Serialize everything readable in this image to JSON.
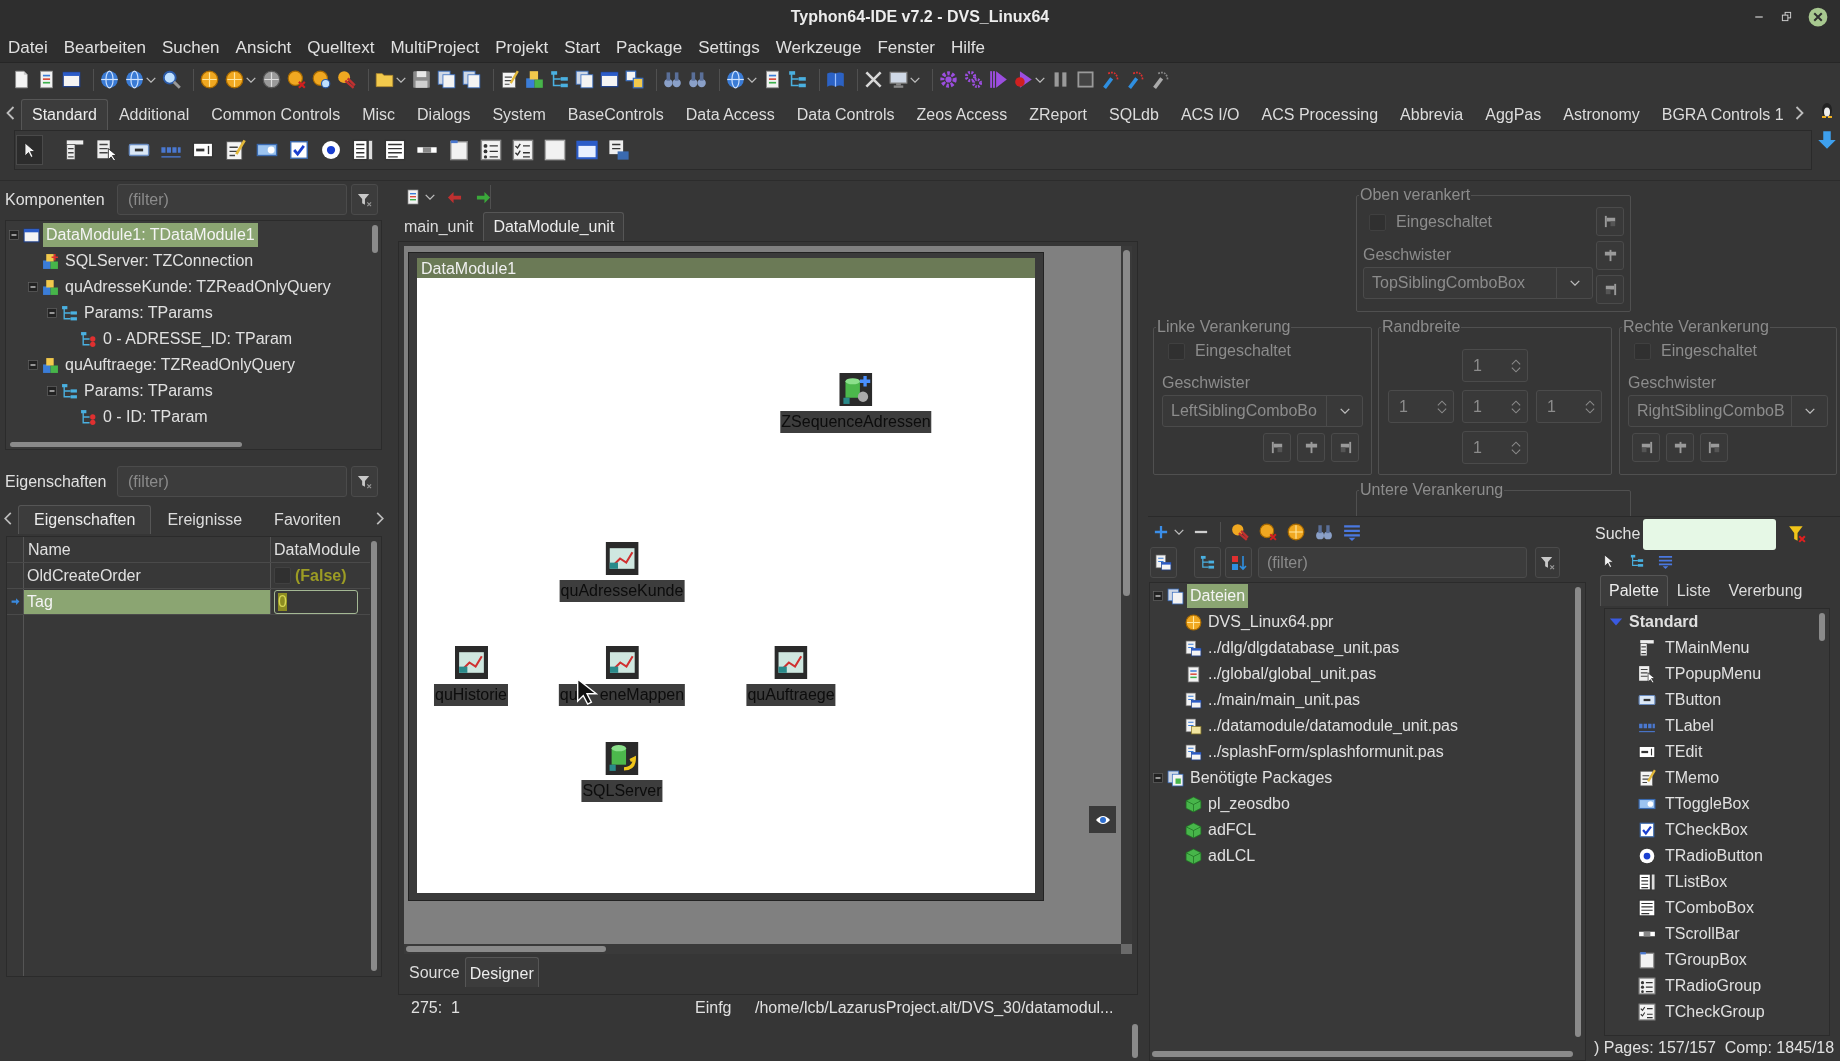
{
  "window": {
    "title": "Typhon64-IDE v7.2 - DVS_Linux64"
  },
  "menu": [
    "Datei",
    "Bearbeiten",
    "Suchen",
    "Ansicht",
    "Quelltext",
    "MultiProject",
    "Projekt",
    "Start",
    "Package",
    "Settings",
    "Werkzeuge",
    "Fenster",
    "Hilfe"
  ],
  "palette_tabs": [
    {
      "label": "Standard",
      "selected": true
    },
    {
      "label": "Additional",
      "selected": false
    },
    {
      "label": "Common Controls",
      "selected": false
    },
    {
      "label": "Misc",
      "selected": false
    },
    {
      "label": "Dialogs",
      "selected": false
    },
    {
      "label": "System",
      "selected": false
    },
    {
      "label": "BaseControls",
      "selected": false
    },
    {
      "label": "Data Access",
      "selected": false
    },
    {
      "label": "Data Controls",
      "selected": false
    },
    {
      "label": "Zeos Access",
      "selected": false
    },
    {
      "label": "ZReport",
      "selected": false
    },
    {
      "label": "SQLdb",
      "selected": false
    },
    {
      "label": "ACS I/O",
      "selected": false
    },
    {
      "label": "ACS Processing",
      "selected": false
    },
    {
      "label": "Abbrevia",
      "selected": false
    },
    {
      "label": "AggPas",
      "selected": false
    },
    {
      "label": "Astronomy",
      "selected": false
    },
    {
      "label": "BGRA Controls 1",
      "selected": false
    }
  ],
  "components": {
    "label": "Komponenten",
    "filter": {
      "placeholder": "(filter)"
    },
    "tree": [
      {
        "text": "DataModule1: TDataModule1",
        "kind": "datamodule",
        "selected": true,
        "expanded": true,
        "children": [
          {
            "text": "SQLServer: TZConnection",
            "kind": "connection",
            "selected": false
          },
          {
            "text": "quAdresseKunde: TZReadOnlyQuery",
            "kind": "query",
            "selected": false,
            "expanded": true,
            "children": [
              {
                "text": "Params: TParams",
                "kind": "params",
                "selected": false,
                "expanded": true,
                "children": [
                  {
                    "text": "0 - ADRESSE_ID: TParam",
                    "kind": "param",
                    "selected": false
                  }
                ]
              }
            ]
          },
          {
            "text": "quAuftraege: TZReadOnlyQuery",
            "kind": "query",
            "selected": false,
            "expanded": true,
            "children": [
              {
                "text": "Params: TParams",
                "kind": "params",
                "selected": false,
                "expanded": true,
                "children": [
                  {
                    "text": "0 - ID: TParam",
                    "kind": "param",
                    "selected": false
                  }
                ]
              }
            ]
          }
        ]
      }
    ]
  },
  "properties": {
    "label": "Eigenschaften",
    "filter": {
      "placeholder": "(filter)"
    },
    "tabs": [
      {
        "label": "Eigenschaften",
        "selected": true
      },
      {
        "label": "Ereignisse",
        "selected": false
      },
      {
        "label": "Favoriten",
        "selected": false
      }
    ],
    "columns": [
      "Name",
      "DataModule"
    ],
    "rows": [
      {
        "name": "OldCreateOrder",
        "kind": "bool",
        "value": "(False)",
        "checked": false,
        "selected": false
      },
      {
        "name": "Tag",
        "kind": "number",
        "value": "0",
        "selected": true
      }
    ]
  },
  "editor": {
    "tabs": [
      {
        "label": "main_unit",
        "selected": false
      },
      {
        "label": "DataModule_unit",
        "selected": true
      }
    ],
    "form_title": "DataModule1",
    "designer_components": [
      {
        "label": "ZSequenceAdressen",
        "kind": "sequence"
      },
      {
        "label": "quAdresseKunde",
        "kind": "query"
      },
      {
        "label": "quHistorie",
        "kind": "query"
      },
      {
        "label": "qu",
        "label_after_cursor": "eneMappen",
        "kind": "query"
      },
      {
        "label": "quAuftraege",
        "kind": "query"
      },
      {
        "label": "SQLServer",
        "kind": "connection"
      }
    ],
    "bottom_tabs": [
      {
        "label": "Source",
        "selected": false
      },
      {
        "label": "Designer",
        "selected": true
      }
    ],
    "status": {
      "position": "275:  1",
      "mode": "Einfg",
      "file": "/home/lcb/LazarusProject.alt/DVS_30/datamodul..."
    }
  },
  "anchors": {
    "disabled": true,
    "top": {
      "title": "Oben verankert",
      "enabled_label": "Eingeschaltet",
      "checked": false,
      "sibling_label": "Geschwister",
      "sibling": "TopSiblingComboBox"
    },
    "left": {
      "title": "Linke Verankerung",
      "enabled_label": "Eingeschaltet",
      "checked": false,
      "sibling_label": "Geschwister",
      "sibling": "LeftSiblingComboBo"
    },
    "border": {
      "title": "Randbreite",
      "values": [
        "1",
        "1",
        "1",
        "1",
        "1"
      ]
    },
    "right": {
      "title": "Rechte Verankerung",
      "enabled_label": "Eingeschaltet",
      "checked": false,
      "sibling_label": "Geschwister",
      "sibling": "RightSiblingComboB"
    },
    "bottom": {
      "title": "Untere Verankerung"
    }
  },
  "project": {
    "filter": {
      "placeholder": "(filter)"
    },
    "tree": [
      {
        "text": "Dateien",
        "kind": "files",
        "selected": true,
        "expanded": true,
        "children": [
          {
            "text": "DVS_Linux64.ppr",
            "kind": "project",
            "selected": false
          },
          {
            "text": "../dlg/dlgdatabase_unit.pas",
            "kind": "form_unit",
            "selected": false
          },
          {
            "text": "../global/global_unit.pas",
            "kind": "unit",
            "selected": false
          },
          {
            "text": "../main/main_unit.pas",
            "kind": "form_unit",
            "selected": false
          },
          {
            "text": "../datamodule/datamodule_unit.pas",
            "kind": "datamodule_unit",
            "selected": false
          },
          {
            "text": "../splashForm/splashformunit.pas",
            "kind": "form_unit",
            "selected": false
          }
        ]
      },
      {
        "text": "Benötigte Packages",
        "kind": "packages",
        "selected": false,
        "expanded": true,
        "children": [
          {
            "text": "pl_zeosdbo",
            "kind": "package",
            "selected": false
          },
          {
            "text": "adFCL",
            "kind": "package",
            "selected": false
          },
          {
            "text": "adLCL",
            "kind": "package",
            "selected": false
          }
        ]
      }
    ]
  },
  "component_list": {
    "search_label": "Suche",
    "tabs": [
      {
        "label": "Palette",
        "selected": true
      },
      {
        "label": "Liste",
        "selected": false
      },
      {
        "label": "Vererbung",
        "selected": false
      }
    ],
    "groups": [
      {
        "title": "Standard",
        "expanded": true,
        "items": [
          {
            "name": "TMainMenu",
            "kind": "mainmenu"
          },
          {
            "name": "TPopupMenu",
            "kind": "popupmenu"
          },
          {
            "name": "TButton",
            "kind": "button"
          },
          {
            "name": "TLabel",
            "kind": "label"
          },
          {
            "name": "TEdit",
            "kind": "edit"
          },
          {
            "name": "TMemo",
            "kind": "memo"
          },
          {
            "name": "TToggleBox",
            "kind": "toggle"
          },
          {
            "name": "TCheckBox",
            "kind": "checkbox"
          },
          {
            "name": "TRadioButton",
            "kind": "radio"
          },
          {
            "name": "TListBox",
            "kind": "listbox"
          },
          {
            "name": "TComboBox",
            "kind": "combobox"
          },
          {
            "name": "TScrollBar",
            "kind": "scrollbar"
          },
          {
            "name": "TGroupBox",
            "kind": "groupbox"
          },
          {
            "name": "TRadioGroup",
            "kind": "radiogroup"
          },
          {
            "name": "TCheckGroup",
            "kind": "checkgroup"
          }
        ]
      }
    ],
    "status": ") Pages: 157/157  Comp: 1845/18"
  }
}
